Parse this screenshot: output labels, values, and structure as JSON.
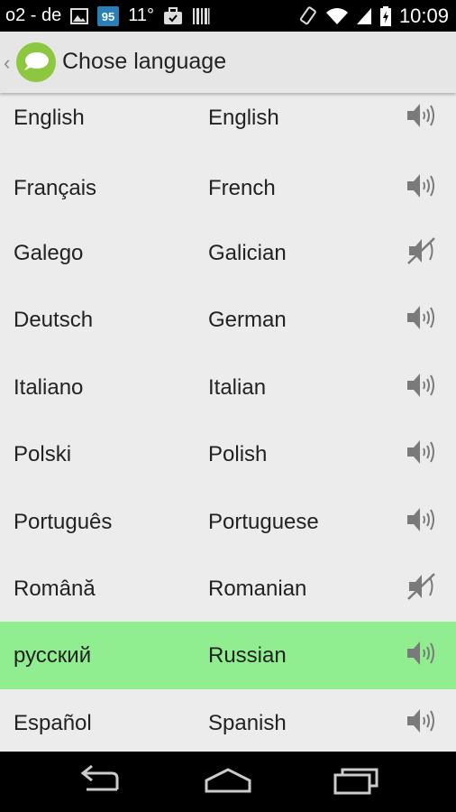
{
  "status_bar": {
    "carrier": "o2 - de",
    "badge_number": "95",
    "temperature": "11°",
    "time": "10:09",
    "icons": [
      "image-icon",
      "app-badge-icon",
      "briefcase-icon",
      "barcode-icon",
      "screen-rotation-icon",
      "wifi-icon",
      "signal-icon",
      "battery-charging-icon"
    ]
  },
  "action_bar": {
    "title": "Chose language",
    "back_glyph": "‹",
    "icons": [
      "back-chevron-icon",
      "speech-bubble-logo-icon"
    ]
  },
  "languages": [
    {
      "native": "English",
      "english": "English",
      "audio": true,
      "selected": false
    },
    {
      "native": "Français",
      "english": "French",
      "audio": true,
      "selected": false
    },
    {
      "native": "Galego",
      "english": "Galician",
      "audio": false,
      "selected": false
    },
    {
      "native": "Deutsch",
      "english": "German",
      "audio": true,
      "selected": false
    },
    {
      "native": "Italiano",
      "english": "Italian",
      "audio": true,
      "selected": false
    },
    {
      "native": "Polski",
      "english": "Polish",
      "audio": true,
      "selected": false
    },
    {
      "native": "Português",
      "english": "Portuguese",
      "audio": true,
      "selected": false
    },
    {
      "native": "Română",
      "english": "Romanian",
      "audio": false,
      "selected": false
    },
    {
      "native": "русский",
      "english": "Russian",
      "audio": true,
      "selected": true
    },
    {
      "native": "Español",
      "english": "Spanish",
      "audio": true,
      "selected": false
    }
  ],
  "nav_bar": {
    "icons": [
      "back-icon",
      "home-icon",
      "recent-apps-icon"
    ]
  },
  "colors": {
    "selected_row": "#90ee90",
    "logo_green": "#8dc63f",
    "list_bg": "#ececec"
  }
}
